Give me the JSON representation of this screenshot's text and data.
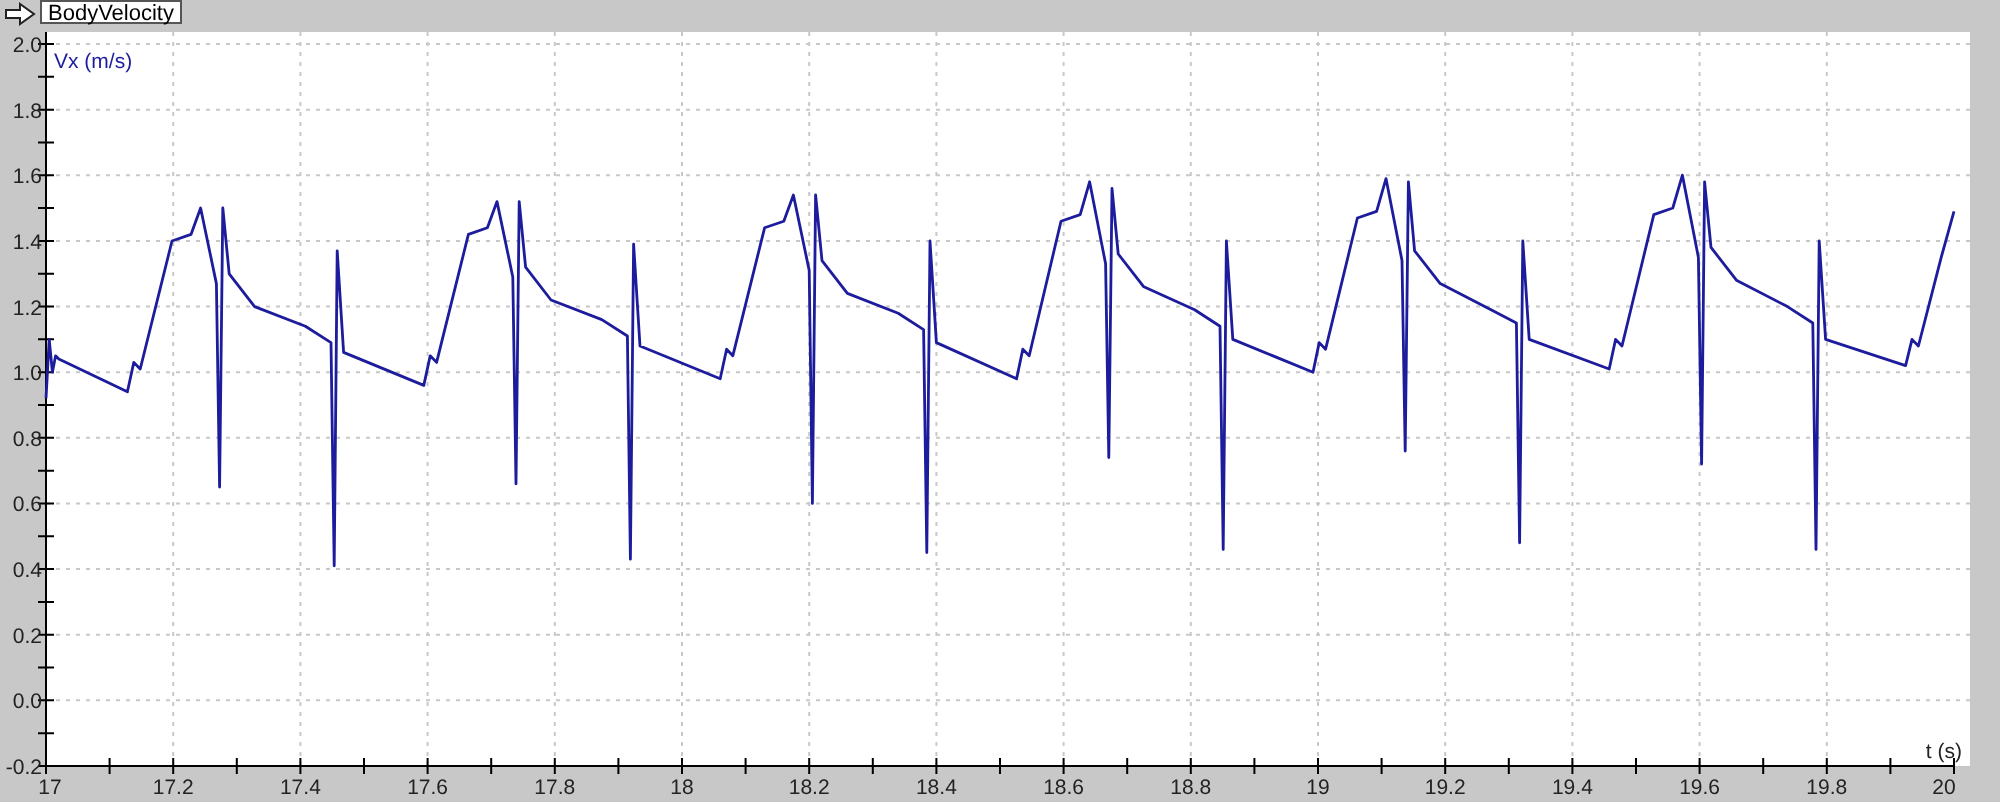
{
  "panel": {
    "chart_data": {
      "type": "line",
      "title": "BodyVelocity",
      "xlabel": "t (s)",
      "ylabel": "Vx (m/s)",
      "grid": true,
      "xlim": [
        17,
        20
      ],
      "ylim": [
        -0.2,
        2.0
      ],
      "xticks": [
        17,
        17.2,
        17.4,
        17.6,
        17.8,
        18,
        18.2,
        18.4,
        18.6,
        18.8,
        19,
        19.2,
        19.4,
        19.6,
        19.8,
        20
      ],
      "yticks": [
        {
          "value": -0.2,
          "label": "-0.2"
        },
        {
          "value": 0,
          "label": "0.0"
        },
        {
          "value": 0.2,
          "label": "0.2"
        },
        {
          "value": 0.4,
          "label": "0.4"
        },
        {
          "value": 0.6,
          "label": "0.6"
        },
        {
          "value": 0.8,
          "label": "0.8"
        },
        {
          "value": 1.0,
          "label": "1.0"
        },
        {
          "value": 1.2,
          "label": "1.2"
        },
        {
          "value": 1.4,
          "label": "1.4"
        },
        {
          "value": 1.6,
          "label": "1.6"
        },
        {
          "value": 1.8,
          "label": "1.8"
        },
        {
          "value": 2.0,
          "label": "2.0"
        }
      ],
      "x": [
        17.0,
        17.005,
        17.01,
        17.015,
        17.02,
        17.128,
        17.138,
        17.148,
        17.198,
        17.228,
        17.243,
        17.268,
        17.273,
        17.278,
        17.288,
        17.328,
        17.408,
        17.448,
        17.453,
        17.458,
        17.468,
        17.594,
        17.604,
        17.614,
        17.664,
        17.694,
        17.709,
        17.734,
        17.739,
        17.744,
        17.754,
        17.794,
        17.874,
        17.914,
        17.919,
        17.924,
        17.934,
        18.06,
        18.07,
        18.08,
        18.13,
        18.16,
        18.175,
        18.2,
        18.205,
        18.21,
        18.22,
        18.26,
        18.34,
        18.38,
        18.385,
        18.39,
        18.4,
        18.526,
        18.536,
        18.546,
        18.596,
        18.626,
        18.641,
        18.666,
        18.671,
        18.676,
        18.686,
        18.726,
        18.806,
        18.846,
        18.851,
        18.856,
        18.866,
        18.992,
        19.002,
        19.012,
        19.062,
        19.092,
        19.107,
        19.132,
        19.137,
        19.142,
        19.152,
        19.192,
        19.272,
        19.312,
        19.317,
        19.322,
        19.332,
        19.458,
        19.468,
        19.478,
        19.528,
        19.558,
        19.573,
        19.598,
        19.603,
        19.608,
        19.618,
        19.658,
        19.738,
        19.778,
        19.783,
        19.788,
        19.798,
        19.924,
        19.934,
        19.944,
        19.98,
        20.0
      ],
      "series": [
        {
          "color": "#1c1c9c",
          "values": [
            0.92,
            1.1,
            1.0,
            1.05,
            1.04,
            0.94,
            1.03,
            1.01,
            1.4,
            1.42,
            1.5,
            1.27,
            0.65,
            1.5,
            1.3,
            1.2,
            1.14,
            1.09,
            0.41,
            1.37,
            1.06,
            0.96,
            1.05,
            1.03,
            1.42,
            1.44,
            1.52,
            1.29,
            0.66,
            1.52,
            1.32,
            1.22,
            1.16,
            1.11,
            0.43,
            1.39,
            1.08,
            0.98,
            1.07,
            1.05,
            1.44,
            1.46,
            1.54,
            1.31,
            0.6,
            1.54,
            1.34,
            1.24,
            1.18,
            1.13,
            0.45,
            1.4,
            1.09,
            0.98,
            1.07,
            1.05,
            1.46,
            1.48,
            1.58,
            1.33,
            0.74,
            1.56,
            1.36,
            1.26,
            1.19,
            1.14,
            0.46,
            1.4,
            1.1,
            1.0,
            1.09,
            1.07,
            1.47,
            1.49,
            1.59,
            1.34,
            0.76,
            1.58,
            1.37,
            1.27,
            1.19,
            1.15,
            0.48,
            1.4,
            1.1,
            1.01,
            1.1,
            1.08,
            1.48,
            1.5,
            1.6,
            1.35,
            0.72,
            1.58,
            1.38,
            1.28,
            1.2,
            1.15,
            0.46,
            1.4,
            1.1,
            1.02,
            1.1,
            1.08,
            1.35,
            1.49
          ]
        }
      ]
    }
  }
}
